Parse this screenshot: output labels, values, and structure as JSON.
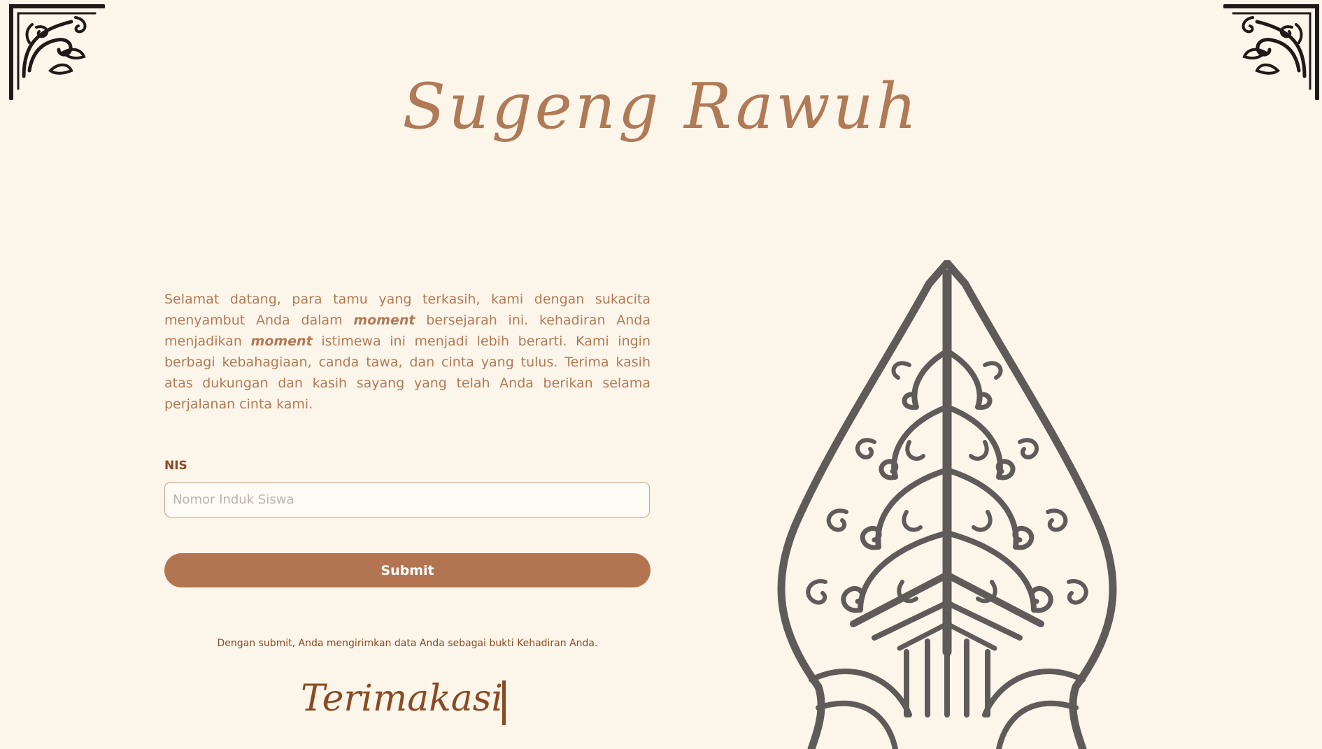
{
  "header": {
    "title": "Sugeng Rawuh"
  },
  "intro": {
    "part1": "Selamat datang, para tamu yang terkasih, kami dengan sukacita menyambut Anda dalam ",
    "moment1": "moment",
    "part2": " bersejarah ini. kehadiran Anda menjadikan ",
    "moment2": "moment",
    "part3": " istimewa ini menjadi lebih berarti. Kami ingin berbagi kebahagiaan, canda tawa, dan cinta yang tulus. Terima kasih atas dukungan dan kasih sayang yang telah Anda berikan selama perjalanan cinta kami."
  },
  "form": {
    "nis_label": "NIS",
    "nis_placeholder": "Nomor Induk Siswa",
    "nis_value": "",
    "submit_label": "Submit",
    "note": "Dengan submit, Anda mengirimkan data Anda sebagai bukti Kehadiran Anda."
  },
  "footer": {
    "thanks": "Terimakasi"
  },
  "decor": {
    "left_corner_icon": "corner-ornament-icon",
    "right_corner_icon": "corner-ornament-icon",
    "gunungan_icon": "gunungan-wayang-icon"
  },
  "colors": {
    "background": "#fcf5ea",
    "accent": "#b37551",
    "text": "#b37a56",
    "dark_text": "#8a4a22",
    "ornament": "#1f1a17",
    "gunungan": "#5f5b59"
  }
}
